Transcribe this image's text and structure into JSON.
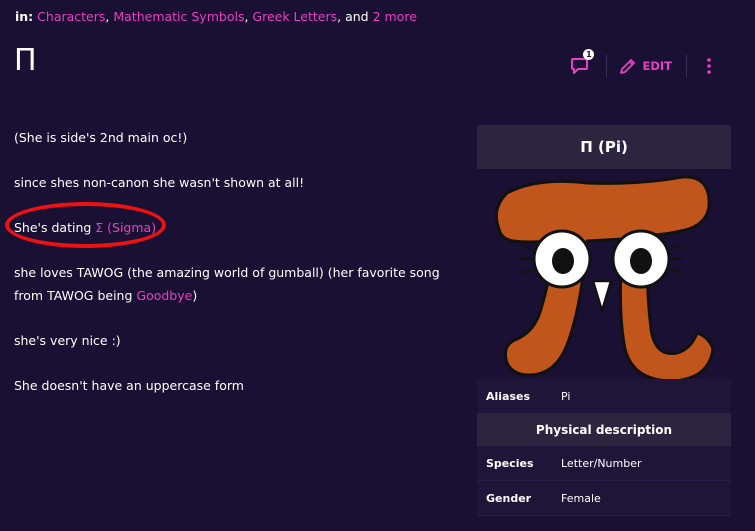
{
  "categories": {
    "prefix": "in:",
    "items": [
      "Characters",
      "Mathematic Symbols",
      "Greek Letters"
    ],
    "sep1": ", ",
    "sep2": ", ",
    "sep_and": ", and ",
    "more": "2 more"
  },
  "page": {
    "title": "Π"
  },
  "actions": {
    "comment_count": "1",
    "edit_label": "EDIT",
    "comment_icon": "comment-bubble-icon",
    "edit_icon": "pencil-icon",
    "more_icon": "kebab-menu-icon"
  },
  "article": {
    "p1": "(She is side's 2nd main oc!)",
    "p2": "since shes non-canon she wasn't shown at all!",
    "p3_text": "She's dating ",
    "p3_link": "Σ (Sigma)",
    "p4_text": "she loves TAWOG (the amazing world of gumball) (her favorite song from TAWOG being ",
    "p4_link": "Goodbye",
    "p4_end": ")",
    "p5": "she's very nice :)",
    "p6": "She doesn't have an uppercase form"
  },
  "infobox": {
    "title": "Π (Pi)",
    "image_icon": "pi-character-image",
    "aliases_label": "Aliases",
    "aliases_value": "Pi",
    "section_physical": "Physical description",
    "species_label": "Species",
    "species_value": "Letter/Number",
    "gender_label": "Gender",
    "gender_value": "Female"
  },
  "colors": {
    "background": "#1a1033",
    "accent": "#e83fc4",
    "highlight_ring": "#ee1111",
    "pi_body": "#c0561c"
  }
}
